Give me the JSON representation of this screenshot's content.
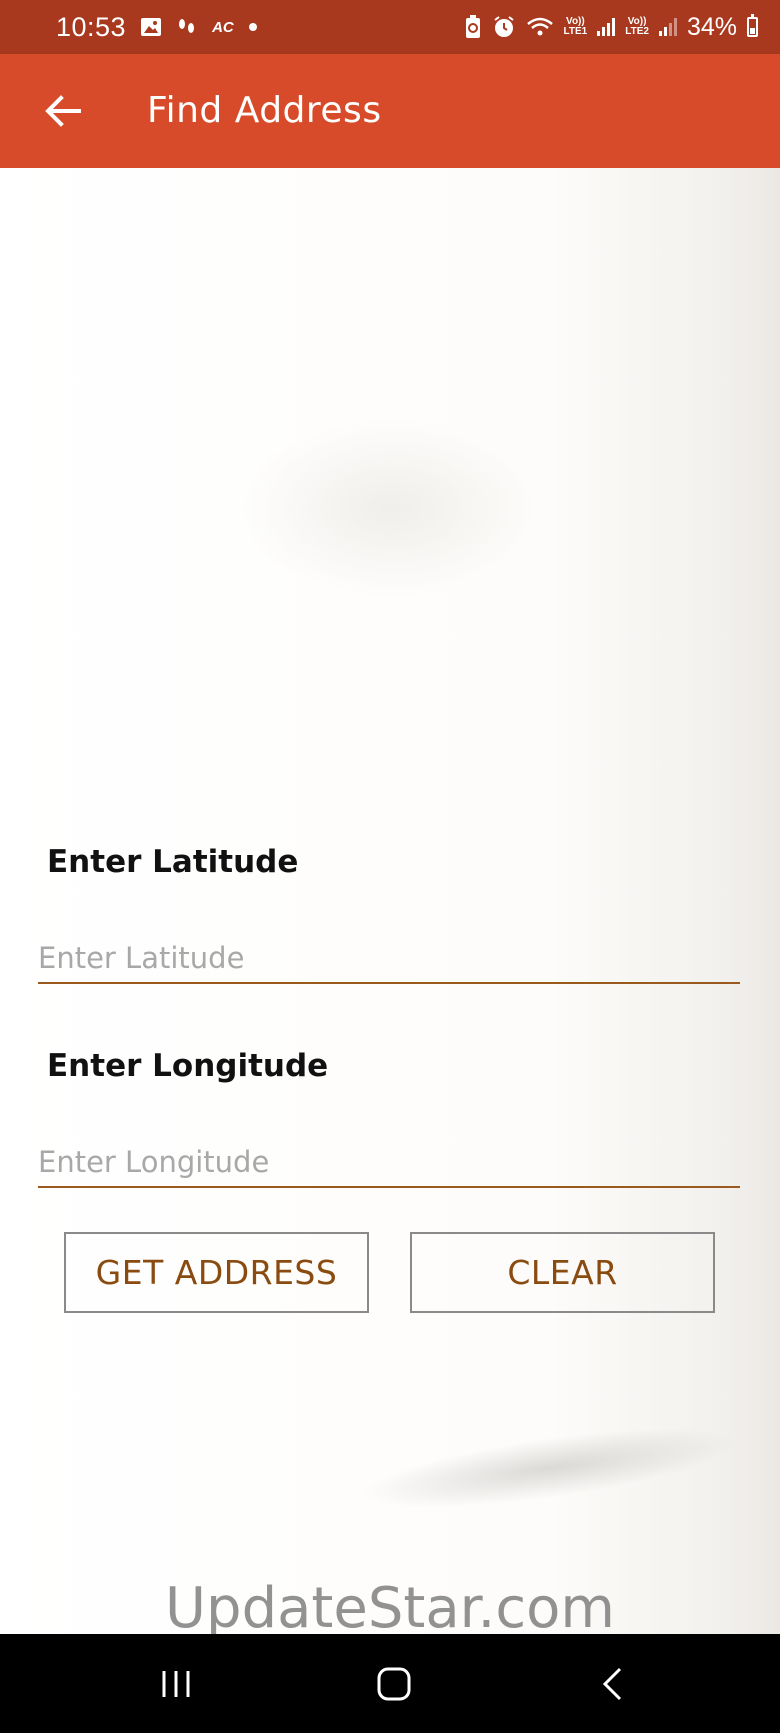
{
  "status_bar": {
    "time": "10:53",
    "left_icons": [
      "image-icon",
      "steps-icon",
      "ac-icon",
      "dot-icon"
    ],
    "ac_text": "AC",
    "sim1": [
      "Vo))",
      "LTE1"
    ],
    "sim2": [
      "Vo))",
      "LTE2"
    ],
    "battery_percent": "34%"
  },
  "app_bar": {
    "title": "Find Address",
    "background": "#d84b2a"
  },
  "form": {
    "latitude_label": "Enter Latitude",
    "latitude_placeholder": "Enter Latitude",
    "latitude_value": "",
    "longitude_label": "Enter Longitude",
    "longitude_placeholder": "Enter Longitude",
    "longitude_value": ""
  },
  "buttons": {
    "get_address": "GET ADDRESS",
    "clear": "CLEAR"
  },
  "watermark": "UpdateStar.com",
  "colors": {
    "status_bar": "#a8391f",
    "accent": "#d84b2a",
    "button_text": "#8a4b10",
    "input_underline": "#9a5a1e"
  }
}
